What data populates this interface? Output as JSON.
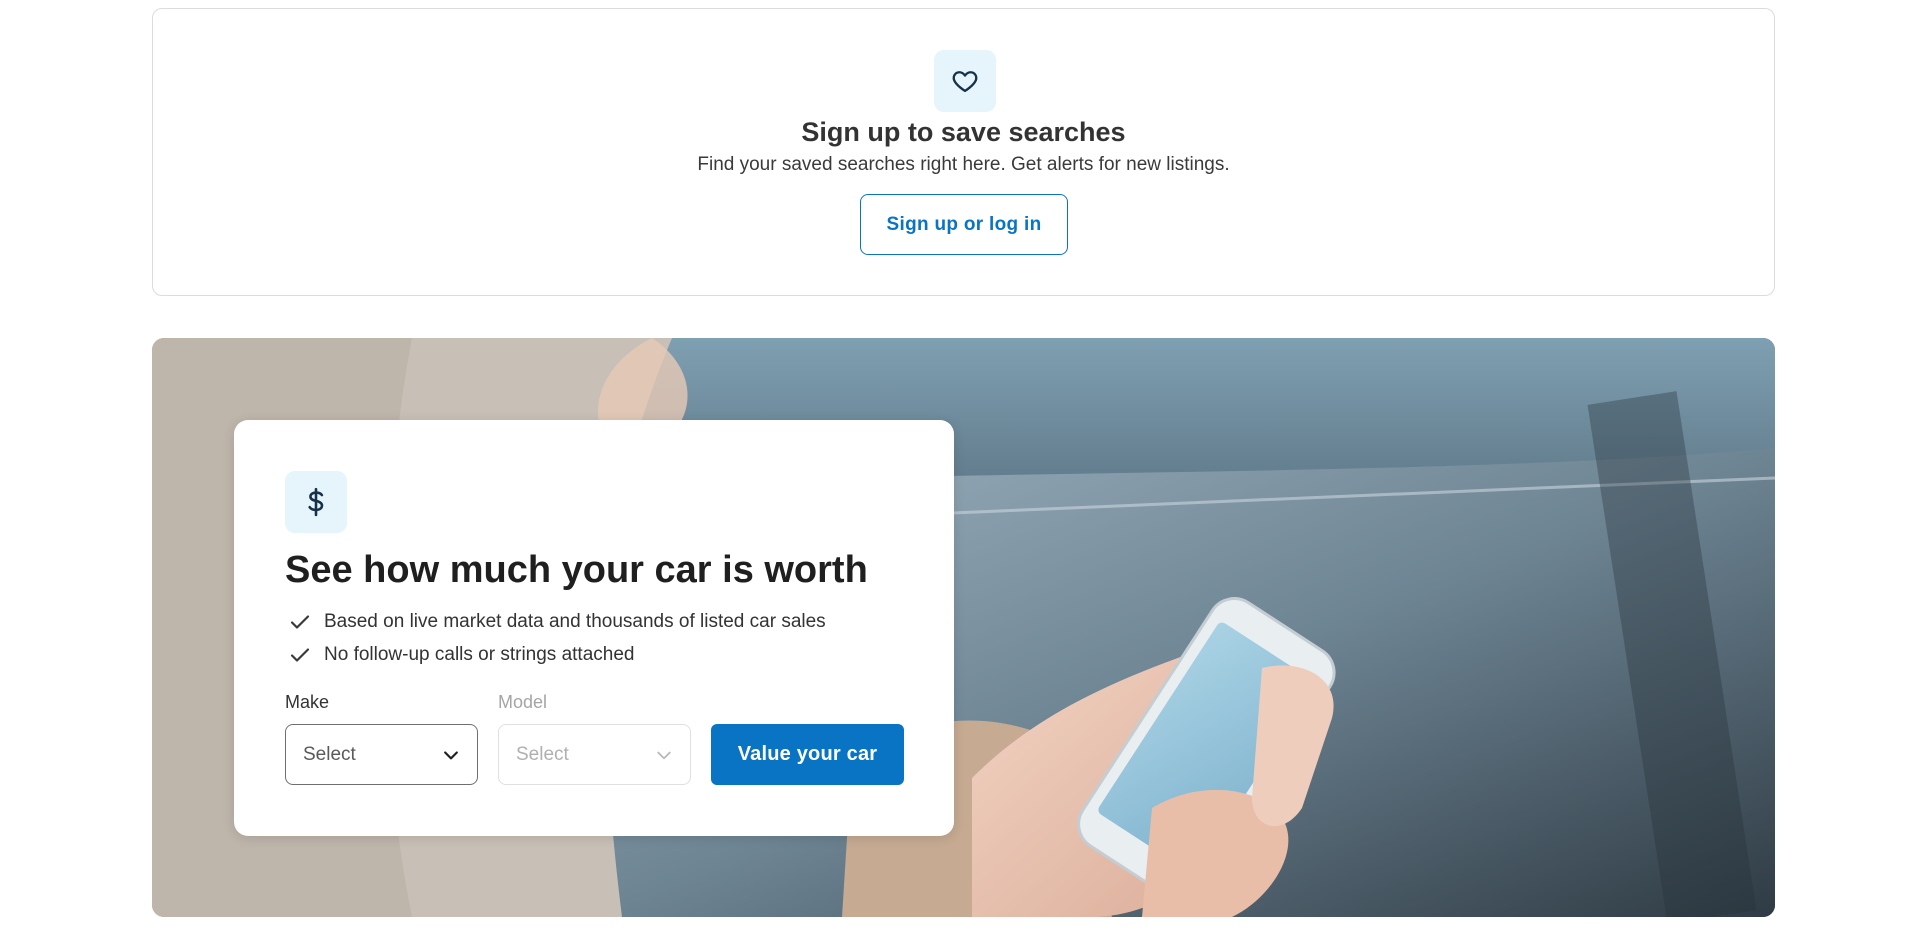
{
  "saved_searches": {
    "icon": "heart-icon",
    "title": "Sign up to save searches",
    "subtitle": "Find your saved searches right here. Get alerts for new listings.",
    "button_label": "Sign up or log in"
  },
  "valuation": {
    "icon": "dollar-icon",
    "title": "See how much your car is worth",
    "bullets": [
      "Based on live market data and thousands of listed car sales",
      "No follow-up calls or strings attached"
    ],
    "make": {
      "label": "Make",
      "placeholder": "Select"
    },
    "model": {
      "label": "Model",
      "placeholder": "Select"
    },
    "button_label": "Value your car"
  },
  "colors": {
    "accent": "#0a74c4",
    "icon_badge_bg": "#e6f4fc"
  }
}
